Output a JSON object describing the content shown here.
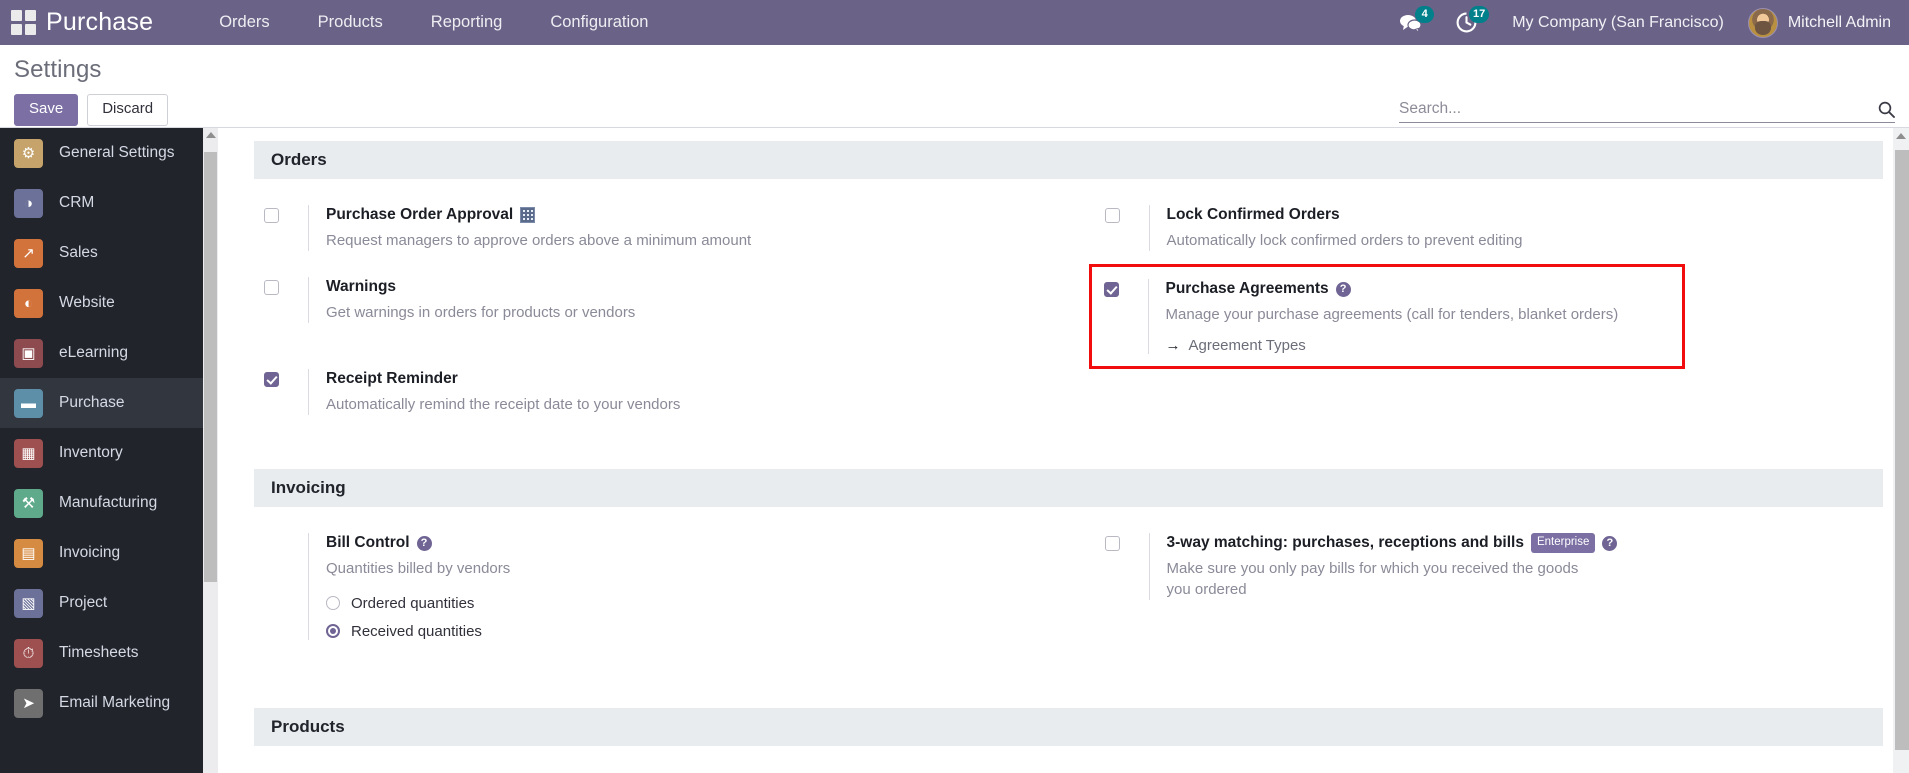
{
  "navbar": {
    "apps_icon": "apps-grid-icon",
    "brand": "Purchase",
    "menu": [
      {
        "label": "Orders"
      },
      {
        "label": "Products"
      },
      {
        "label": "Reporting"
      },
      {
        "label": "Configuration"
      }
    ],
    "messages": {
      "icon": "messages-icon",
      "count": "4"
    },
    "activities": {
      "icon": "activity-clock-icon",
      "count": "17"
    },
    "company": "My Company (San Francisco)",
    "user": "Mitchell Admin",
    "accent_color": "#6b6387",
    "badge_color": "#00808a"
  },
  "control_panel": {
    "title": "Settings",
    "save_label": "Save",
    "discard_label": "Discard",
    "search_placeholder": "Search...",
    "search_value": "",
    "search_icon": "search-icon"
  },
  "sidebar": {
    "items": [
      {
        "label": "General Settings",
        "icon": "gear-icon",
        "glyph": "⚙",
        "color": "#c5a36b",
        "active": false
      },
      {
        "label": "CRM",
        "icon": "handshake-icon",
        "glyph": "◑",
        "color": "#6b7198",
        "active": false
      },
      {
        "label": "Sales",
        "icon": "chart-line-icon",
        "glyph": "↗",
        "color": "#d3733c",
        "active": false
      },
      {
        "label": "Website",
        "icon": "globe-icon",
        "glyph": "◐",
        "color": "#d3733c",
        "active": false
      },
      {
        "label": "eLearning",
        "icon": "presentation-icon",
        "glyph": "▣",
        "color": "#8d4a4f",
        "active": false
      },
      {
        "label": "Purchase",
        "icon": "purchase-card-icon",
        "glyph": "▬",
        "color": "#5d8fa8",
        "active": true
      },
      {
        "label": "Inventory",
        "icon": "box-icon",
        "glyph": "▦",
        "color": "#9e4f4f",
        "active": false
      },
      {
        "label": "Manufacturing",
        "icon": "wrench-icon",
        "glyph": "⚒",
        "color": "#5faa8a",
        "active": false
      },
      {
        "label": "Invoicing",
        "icon": "invoice-icon",
        "glyph": "▤",
        "color": "#d68b42",
        "active": false
      },
      {
        "label": "Project",
        "icon": "puzzle-icon",
        "glyph": "▧",
        "color": "#6b7198",
        "active": false
      },
      {
        "label": "Timesheets",
        "icon": "stopwatch-icon",
        "glyph": "⏱",
        "color": "#9e4f4f",
        "active": false
      },
      {
        "label": "Email Marketing",
        "icon": "paper-plane-icon",
        "glyph": "➤",
        "color": "#6f6f6f",
        "active": false
      }
    ]
  },
  "settings": {
    "sections": [
      {
        "name": "Orders",
        "title": "Orders"
      },
      {
        "name": "Invoicing",
        "title": "Invoicing"
      },
      {
        "name": "Products",
        "title": "Products"
      }
    ],
    "orders": {
      "purchase_order_approval": {
        "title": "Purchase Order Approval",
        "description": "Request managers to approve orders above a minimum amount",
        "checked": false,
        "company_icon": "company-building-icon"
      },
      "warnings": {
        "title": "Warnings",
        "description": "Get warnings in orders for products or vendors",
        "checked": false
      },
      "receipt_reminder": {
        "title": "Receipt Reminder",
        "description": "Automatically remind the receipt date to your vendors",
        "checked": true
      },
      "lock_confirmed_orders": {
        "title": "Lock Confirmed Orders",
        "description": "Automatically lock confirmed orders to prevent editing",
        "checked": false
      },
      "purchase_agreements": {
        "title": "Purchase Agreements",
        "description": "Manage your purchase agreements (call for tenders, blanket orders)",
        "checked": true,
        "help_icon": "help-circle-icon",
        "link_label": "Agreement Types",
        "link_arrow": "→",
        "highlighted": true,
        "highlight_color": "#f10d0d"
      }
    },
    "invoicing": {
      "bill_control": {
        "title": "Bill Control",
        "description": "Quantities billed by vendors",
        "help_icon": "help-circle-icon",
        "options": [
          {
            "label": "Ordered quantities",
            "selected": false
          },
          {
            "label": "Received quantities",
            "selected": true
          }
        ]
      },
      "three_way_matching": {
        "title": "3-way matching: purchases, receptions and bills",
        "description": "Make sure you only pay bills for which you received the goods you ordered",
        "checked": false,
        "badge": "Enterprise",
        "help_icon": "help-circle-icon"
      }
    }
  }
}
